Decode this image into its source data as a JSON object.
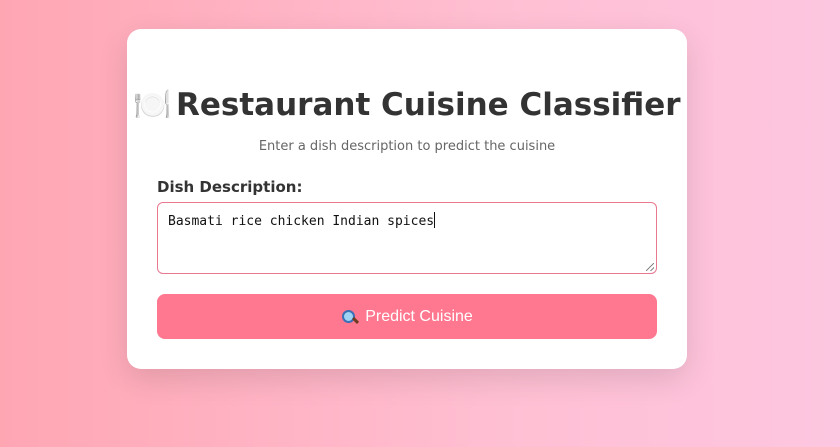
{
  "header": {
    "icon": "plate-with-cutlery-icon",
    "icon_glyph": "🍽️",
    "title": "Restaurant Cuisine Classifier",
    "subtitle": "Enter a dish description to predict the cuisine"
  },
  "form": {
    "label": "Dish Description:",
    "textarea_value": "Basmati rice chicken Indian spices",
    "submit_icon": "magnifying-glass-icon",
    "submit_label": "Predict Cuisine"
  },
  "colors": {
    "background_left": "#ffa6b3",
    "background_right": "#fdc6e0",
    "button": "#ff788f",
    "textarea_border": "#e9788f",
    "title": "#333333"
  }
}
